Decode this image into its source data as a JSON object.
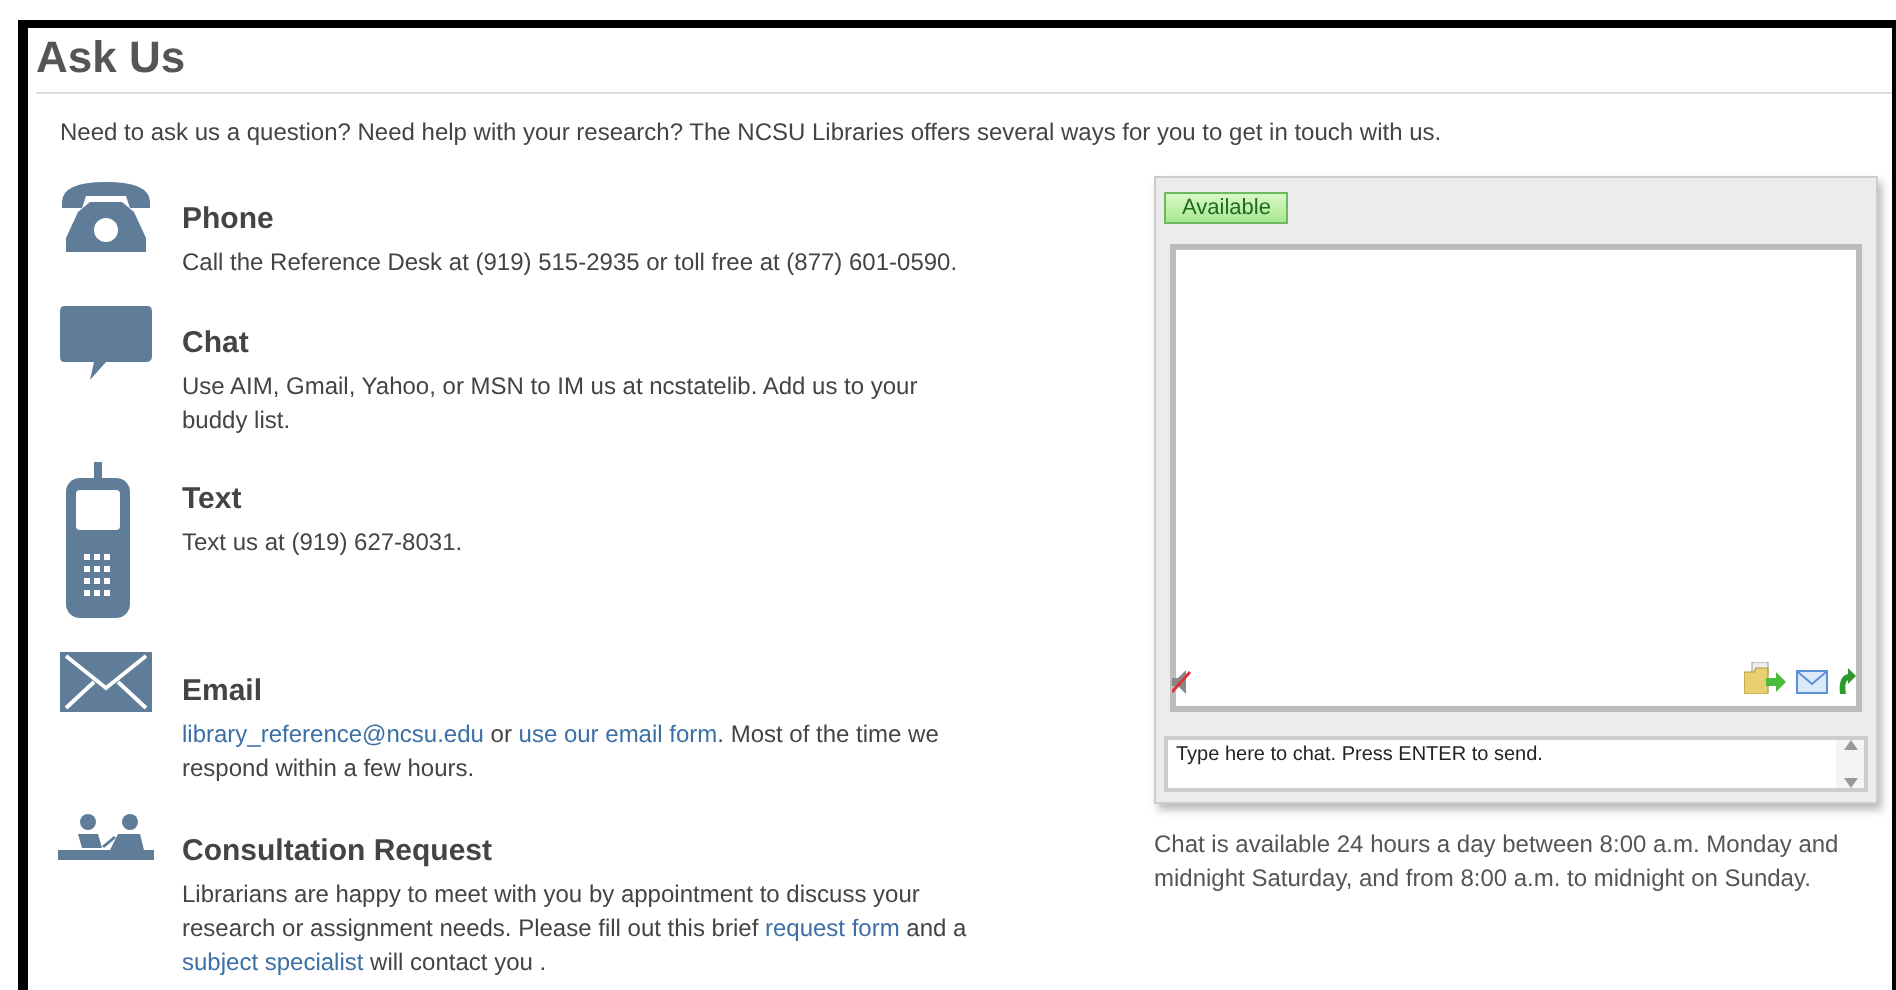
{
  "page": {
    "title": "Ask Us",
    "intro": "Need to ask us a question? Need help with your research? The NCSU Libraries offers several ways for you to get in touch with us."
  },
  "sections": [
    {
      "kind": "phone",
      "title": "Phone",
      "body": [
        {
          "kind": "text",
          "text": "Call the Reference Desk at (919) 515-2935 or toll free at (877) 601-0590."
        }
      ]
    },
    {
      "kind": "chat",
      "title": "Chat",
      "body": [
        {
          "kind": "text",
          "text": "Use AIM, Gmail, Yahoo, or MSN to IM us at ncstatelib. Add us to your buddy list."
        }
      ]
    },
    {
      "kind": "text",
      "title": "Text",
      "body": [
        {
          "kind": "text",
          "text": "Text us at (919) 627-8031."
        }
      ]
    },
    {
      "kind": "email",
      "title": "Email",
      "body": [
        {
          "kind": "link",
          "text": "library_reference@ncsu.edu"
        },
        {
          "kind": "text",
          "text": " or "
        },
        {
          "kind": "link",
          "text": "use our email form"
        },
        {
          "kind": "text",
          "text": ". Most of the time we respond within a few hours."
        }
      ]
    },
    {
      "kind": "consultation",
      "title": "Consultation Request",
      "body": [
        {
          "kind": "text",
          "text": "Librarians are happy to meet with you by appointment to discuss your research or assignment needs. Please fill out this brief "
        },
        {
          "kind": "link",
          "text": "request form"
        },
        {
          "kind": "text",
          "text": " and a "
        },
        {
          "kind": "link",
          "text": "subject specialist"
        },
        {
          "kind": "text",
          "text": " will contact you ."
        }
      ]
    }
  ],
  "chat_widget": {
    "status": "Available",
    "input": {
      "value": "Type here to chat. Press ENTER to send."
    },
    "note": "Chat is available 24 hours a day between 8:00 a.m. Monday and midnight Saturday, and from 8:00 a.m. to midnight on Sunday."
  }
}
